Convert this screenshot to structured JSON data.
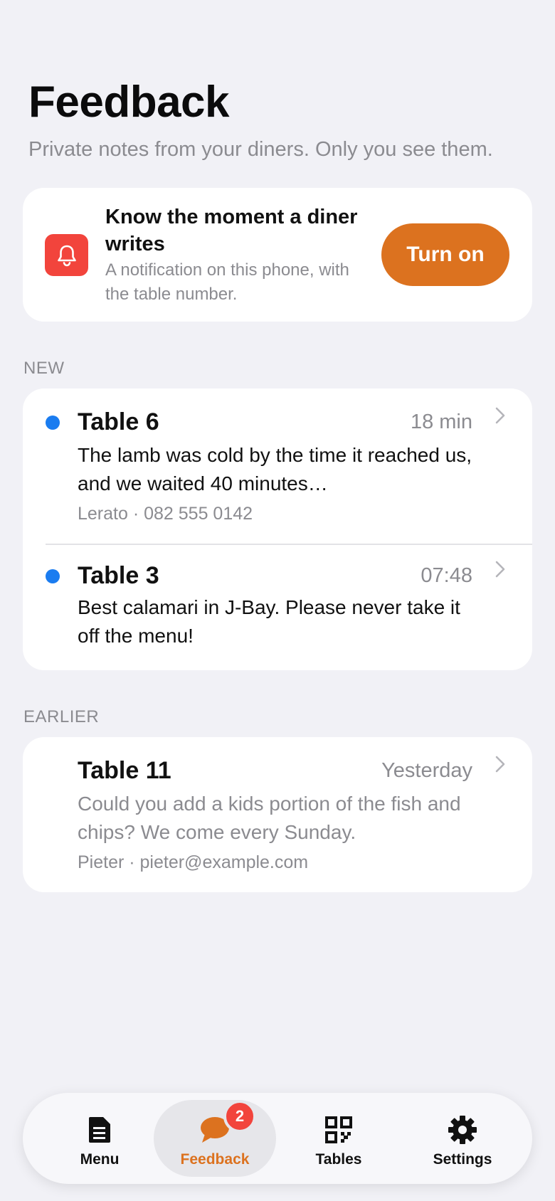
{
  "header": {
    "title": "Feedback",
    "subtitle": "Private notes from your diners. Only you see them."
  },
  "notify": {
    "title": "Know the moment a diner writes",
    "subtitle": "A notification on this phone, with the table number.",
    "button_label": "Turn on",
    "icon": "bell-icon"
  },
  "sections": {
    "new_label": "NEW",
    "earlier_label": "EARLIER"
  },
  "new_items": [
    {
      "table": "Table 6",
      "time": "18 min",
      "message": "The lamb was cold by the time it reached us, and we waited 40 minutes…",
      "meta": "Lerato · 082 555 0142",
      "unread": true
    },
    {
      "table": "Table 3",
      "time": "07:48",
      "message": "Best calamari in J-Bay. Please never take it off the menu!",
      "unread": true
    }
  ],
  "earlier_items": [
    {
      "table": "Table 11",
      "time": "Yesterday",
      "message": "Could you add a kids portion of the fish and chips? We come every Sunday.",
      "meta": "Pieter · pieter@example.com",
      "unread": false
    }
  ],
  "tabbar": {
    "tabs": [
      {
        "label": "Menu",
        "icon": "document-icon"
      },
      {
        "label": "Feedback",
        "icon": "chat-bubble-icon",
        "badge": "2",
        "active": true
      },
      {
        "label": "Tables",
        "icon": "qr-code-icon"
      },
      {
        "label": "Settings",
        "icon": "gear-icon"
      }
    ]
  },
  "colors": {
    "accent": "#dc721f",
    "unread_dot": "#1a7cf0",
    "badge": "#f2443c",
    "background": "#f1f1f6"
  }
}
